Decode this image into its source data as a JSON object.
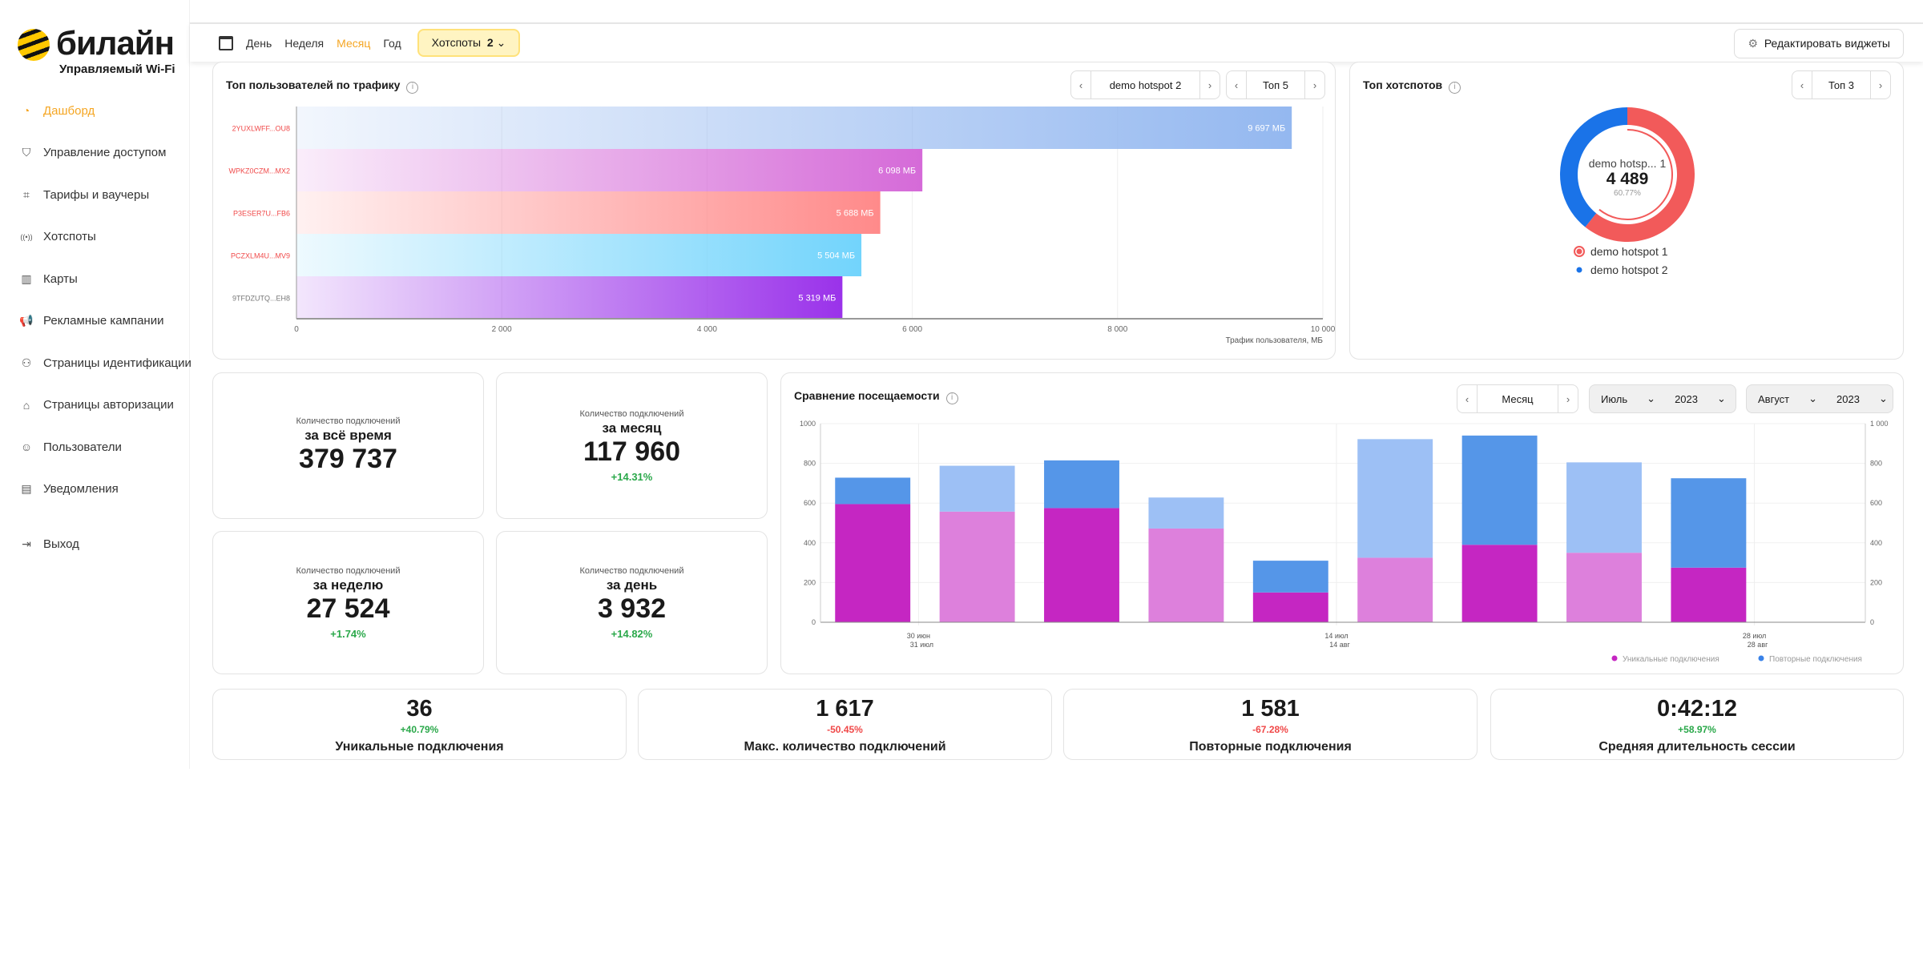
{
  "brand": {
    "name": "билайн",
    "subtitle": "Управляемый Wi-Fi"
  },
  "sidebar": {
    "items": [
      {
        "label": "Дашборд",
        "icon": "dashboard-icon",
        "active": true
      },
      {
        "label": "Управление доступом",
        "icon": "shield-icon"
      },
      {
        "label": "Тарифы и ваучеры",
        "icon": "voucher-icon"
      },
      {
        "label": "Хотспоты",
        "icon": "hotspot-icon"
      },
      {
        "label": "Карты",
        "icon": "map-icon"
      },
      {
        "label": "Рекламные кампании",
        "icon": "megaphone-icon"
      },
      {
        "label": "Страницы идентификации",
        "icon": "user-id-icon"
      },
      {
        "label": "Страницы авторизации",
        "icon": "home-icon"
      },
      {
        "label": "Пользователи",
        "icon": "user-icon"
      },
      {
        "label": "Уведомления",
        "icon": "notification-icon"
      },
      {
        "label": "Выход",
        "icon": "logout-icon"
      }
    ]
  },
  "topbar": {
    "periods": [
      "День",
      "Неделя",
      "Месяц",
      "Год"
    ],
    "active_period": "Месяц",
    "hotspots_label": "Хотспоты",
    "hotspots_count": "2",
    "edit_widgets": "Редактировать виджеты"
  },
  "top_users": {
    "title": "Топ пользователей по трафику",
    "hotspot": "demo hotspot 2",
    "top": "Топ 5"
  },
  "top_hotspots": {
    "title": "Топ хотспотов",
    "top": "Топ 3",
    "center_name": "demo hotsp... 1",
    "center_value": "4 489",
    "center_percent": "60.77%"
  },
  "stats": [
    {
      "label": "Количество подключений",
      "period": "за всё время",
      "value": "379 737",
      "change": ""
    },
    {
      "label": "Количество подключений",
      "period": "за месяц",
      "value": "117 960",
      "change": "+14.31%"
    },
    {
      "label": "Количество подключений",
      "period": "за неделю",
      "value": "27 524",
      "change": "+1.74%"
    },
    {
      "label": "Количество подключений",
      "period": "за день",
      "value": "3 932",
      "change": "+14.82%"
    }
  ],
  "comparison": {
    "title": "Сравнение посещаемости",
    "granularity": "Месяц",
    "period1": {
      "month": "Июль",
      "year": "2023"
    },
    "period2": {
      "month": "Август",
      "year": "2023"
    }
  },
  "kpis": [
    {
      "value": "36",
      "change": "+40.79%",
      "trend": "up",
      "label": "Уникальные подключения"
    },
    {
      "value": "1 617",
      "change": "-50.45%",
      "trend": "down",
      "label": "Макс. количество подключений"
    },
    {
      "value": "1 581",
      "change": "-67.28%",
      "trend": "down",
      "label": "Повторные подключения"
    },
    {
      "value": "0:42:12",
      "change": "+58.97%",
      "trend": "up",
      "label": "Средняя длительность сессии"
    }
  ],
  "chart_data": [
    {
      "type": "bar",
      "orientation": "horizontal",
      "categories": [
        "2YUXLWFF...OU8",
        "WPKZ0CZM...MX2",
        "P3ESER7U...FB6",
        "PCZXLM4U...MV9",
        "9TFDZUTQ...EH8"
      ],
      "values": [
        9697,
        6098,
        5688,
        5504,
        5319
      ],
      "value_labels": [
        "9 697 МБ",
        "6 098 МБ",
        "5 688 МБ",
        "5 504 МБ",
        "5 319 МБ"
      ],
      "xlabel": "Трафик пользователя, МБ",
      "xlim": [
        0,
        10000
      ],
      "xticks": [
        "0",
        "2 000",
        "4 000",
        "6 000",
        "8 000",
        "10 000"
      ],
      "grid": true,
      "colors": [
        "#94b8f0",
        "#d56ad8",
        "#ff8a8a",
        "#72d4fc",
        "#9a32ea"
      ]
    },
    {
      "type": "pie",
      "variant": "donut",
      "labels": [
        "demo hotspot 1",
        "demo hotspot 2"
      ],
      "values": [
        4489,
        2898
      ],
      "colors": [
        "#f25a5a",
        "#1a73e8"
      ],
      "legend": "bottom"
    },
    {
      "type": "bar",
      "stacked": true,
      "ylim": [
        0,
        1000
      ],
      "yticks": [
        "0",
        "200",
        "400",
        "600",
        "800",
        "1000"
      ],
      "yticks_right": [
        "0",
        "200",
        "400",
        "600",
        "800",
        "1 000"
      ],
      "xtick_labels": [
        [
          "30 июн",
          "31 июл"
        ],
        [
          "14 июл",
          "14 авг"
        ],
        [
          "28 июл",
          "28 авг"
        ]
      ],
      "bar_period": [
        "Июль",
        "Август",
        "Июль",
        "Август",
        "Июль",
        "Август",
        "Июль",
        "Август",
        "Июль"
      ],
      "series": [
        {
          "name": "Уникальные подключения",
          "values": [
            595,
            557,
            575,
            472,
            150,
            325,
            390,
            350,
            275
          ],
          "colors": [
            "#c526c2",
            "#dd80dc"
          ]
        },
        {
          "name": "Повторные подключения",
          "values": [
            133,
            231,
            240,
            156,
            160,
            597,
            550,
            455,
            450
          ],
          "colors": [
            "#5596e8",
            "#9dc0f5"
          ]
        }
      ],
      "legend": "bottom-right",
      "grid": true
    }
  ]
}
